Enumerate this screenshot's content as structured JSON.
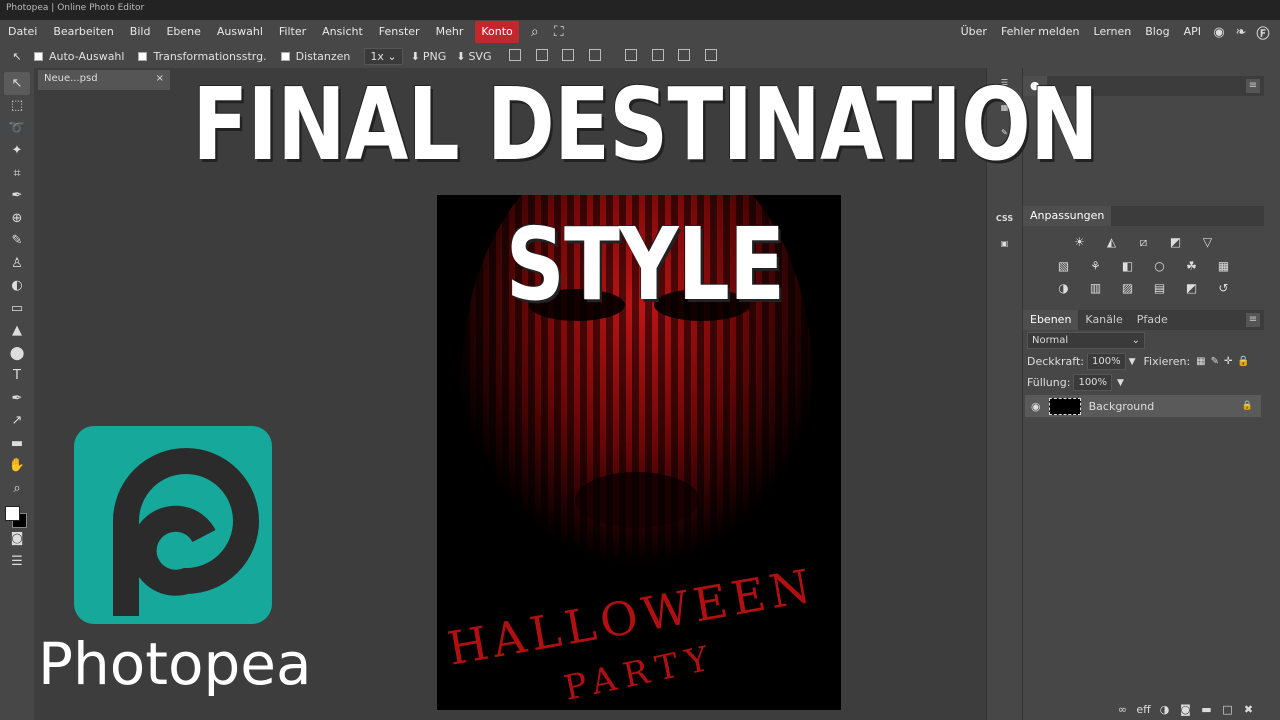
{
  "window": {
    "title": "Photopea | Online Photo Editor"
  },
  "menu": {
    "items": [
      "Datei",
      "Bearbeiten",
      "Bild",
      "Ebene",
      "Auswahl",
      "Filter",
      "Ansicht",
      "Fenster",
      "Mehr"
    ],
    "active": "Konto",
    "right": [
      "Über",
      "Fehler melden",
      "Lernen",
      "Blog",
      "API"
    ],
    "accent_color": "#c1272d"
  },
  "options": {
    "auto_select": "Auto-Auswahl",
    "transform_controls": "Transformationsstrg.",
    "distances": "Distanzen",
    "zoom": "1x",
    "png": "PNG",
    "svg": "SVG"
  },
  "document": {
    "tab_title": "Neue...psd",
    "close": "×"
  },
  "strip": {
    "css_label": "CSS"
  },
  "adjustments": {
    "title": "Anpassungen"
  },
  "layers": {
    "tabs": [
      "Ebenen",
      "Kanäle",
      "Pfade"
    ],
    "blend_mode": "Normal",
    "opacity_label": "Deckkraft:",
    "opacity": "100%",
    "lock_label": "Fixieren:",
    "fill_label": "Füllung:",
    "fill": "100%",
    "layer_name": "Background"
  },
  "poster": {
    "line1": "HALLOWEEN",
    "line2": "PARTY",
    "color": "#b01010"
  },
  "overlay": {
    "headline": "FINAL DESTINATION STYLE",
    "logo_text": "Photopea",
    "logo_color": "#16a89a"
  }
}
